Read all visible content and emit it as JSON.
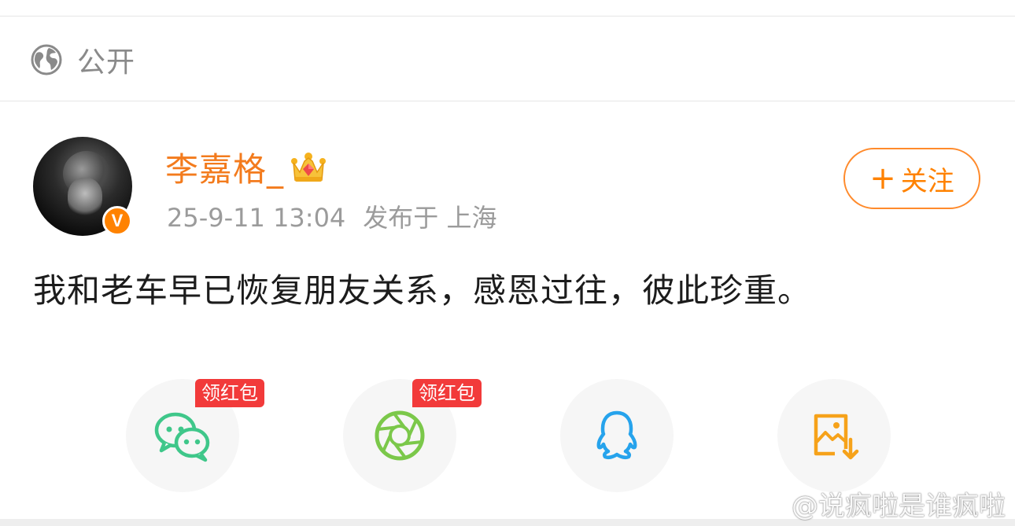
{
  "visibility": {
    "label": "公开",
    "icon": "globe-icon"
  },
  "post": {
    "author": {
      "name": "李嘉格_",
      "badge_icon": "crown-icon",
      "verified_icon": "verified-v-icon",
      "verified_text": "V"
    },
    "time": "25-9-11 13:04",
    "location": "发布于 上海",
    "follow_label": "关注",
    "follow_plus": "+",
    "text": "我和老车早已恢复朋友关系，感恩过往，彼此珍重。"
  },
  "share": {
    "items": [
      {
        "icon": "wechat-icon",
        "badge": "领红包"
      },
      {
        "icon": "moments-icon",
        "badge": "领红包"
      },
      {
        "icon": "qq-icon"
      },
      {
        "icon": "save-image-icon"
      }
    ]
  },
  "watermark": {
    "text": "@说疯啦是谁疯啦",
    "icon": "weibo-icon"
  },
  "colors": {
    "accent_orange": "#ff8200",
    "username_orange": "#f37b1d",
    "wechat_green": "#3fc78a",
    "moments_green": "#7bc84a",
    "qq_blue": "#26a3ec",
    "save_orange": "#f6a21a",
    "badge_red": "#f23a3a"
  }
}
